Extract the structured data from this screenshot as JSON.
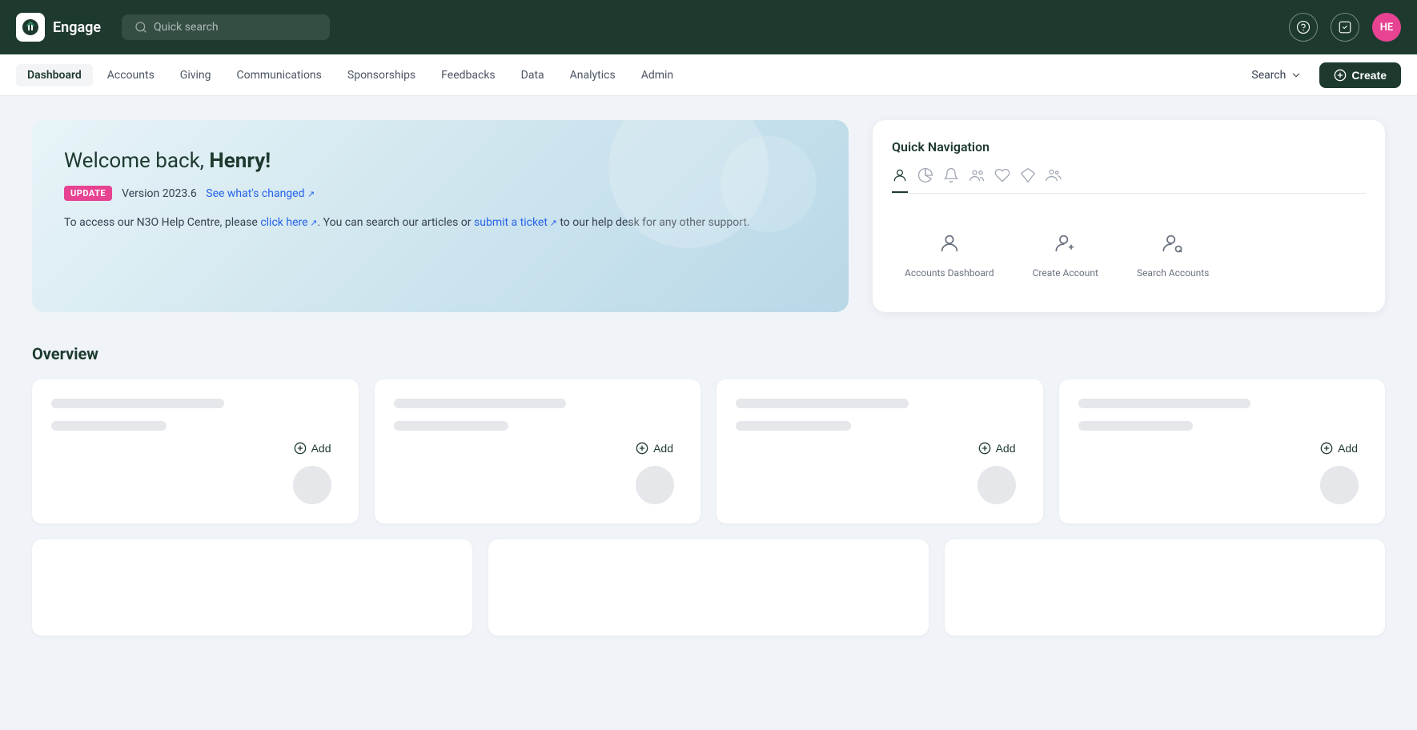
{
  "app": {
    "name": "Engage",
    "logo_alt": "engage-logo"
  },
  "topnav": {
    "search_placeholder": "Quick search",
    "help_label": "?",
    "avatar_initials": "HE"
  },
  "secnav": {
    "tabs": [
      {
        "id": "dashboard",
        "label": "Dashboard",
        "active": true
      },
      {
        "id": "accounts",
        "label": "Accounts",
        "active": false
      },
      {
        "id": "giving",
        "label": "Giving",
        "active": false
      },
      {
        "id": "communications",
        "label": "Communications",
        "active": false
      },
      {
        "id": "sponsorships",
        "label": "Sponsorships",
        "active": false
      },
      {
        "id": "feedbacks",
        "label": "Feedbacks",
        "active": false
      },
      {
        "id": "data",
        "label": "Data",
        "active": false
      },
      {
        "id": "analytics",
        "label": "Analytics",
        "active": false
      },
      {
        "id": "admin",
        "label": "Admin",
        "active": false
      }
    ],
    "search_label": "Search",
    "create_label": "Create"
  },
  "welcome": {
    "title_prefix": "Welcome back, ",
    "title_name": "Henry!",
    "update_badge": "UPDATE",
    "version": "Version 2023.6",
    "see_whats_changed": "See what's changed",
    "help_text_1": "To access our N3O Help Centre, please ",
    "click_here": "click here",
    "help_text_2": ". You can search our articles or ",
    "submit_ticket": "submit a ticket",
    "help_text_3": " to our help desk for any other support."
  },
  "quick_nav": {
    "title": "Quick Navigation",
    "tabs": [
      {
        "id": "accounts-tab",
        "icon": "👤",
        "active": true
      },
      {
        "id": "giving-tab",
        "icon": "🥧",
        "active": false
      },
      {
        "id": "comms-tab",
        "icon": "🔔",
        "active": false
      },
      {
        "id": "sponsorships-tab",
        "icon": "👥",
        "active": false
      },
      {
        "id": "feedbacks-tab",
        "icon": "♡",
        "active": false
      },
      {
        "id": "data-tab",
        "icon": "◇",
        "active": false
      },
      {
        "id": "admin-tab",
        "icon": "👥",
        "active": false
      }
    ],
    "items": [
      {
        "id": "accounts-dashboard",
        "label": "Accounts Dashboard",
        "icon": "person"
      },
      {
        "id": "create-account",
        "label": "Create Account",
        "icon": "person-add"
      },
      {
        "id": "search-accounts",
        "label": "Search Accounts",
        "icon": "person-search"
      }
    ]
  },
  "overview": {
    "title": "Overview",
    "cards": [
      {
        "id": "card-1",
        "add_label": "Add"
      },
      {
        "id": "card-2",
        "add_label": "Add"
      },
      {
        "id": "card-3",
        "add_label": "Add"
      },
      {
        "id": "card-4",
        "add_label": "Add"
      }
    ],
    "bottom_cards": [
      {
        "id": "bottom-card-1"
      },
      {
        "id": "bottom-card-2"
      },
      {
        "id": "bottom-card-3"
      }
    ]
  }
}
